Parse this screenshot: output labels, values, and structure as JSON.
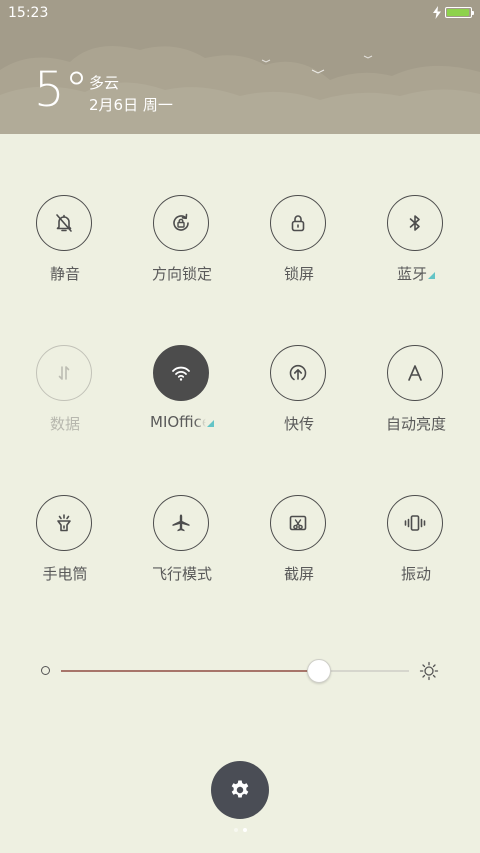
{
  "status_bar": {
    "time": "15:23",
    "battery_level": 0.95,
    "charging": true
  },
  "weather": {
    "temperature": "5°",
    "condition": "多云",
    "date": "2月6日 周一"
  },
  "toggles": [
    {
      "label": "静音",
      "icon": "bell-off-icon",
      "state": "off"
    },
    {
      "label": "方向锁定",
      "icon": "rotation-lock-icon",
      "state": "off"
    },
    {
      "label": "锁屏",
      "icon": "lock-icon",
      "state": "off"
    },
    {
      "label": "蓝牙",
      "icon": "bluetooth-icon",
      "state": "off",
      "has_submenu": true
    },
    {
      "label": "数据",
      "icon": "mobile-data-icon",
      "state": "disabled"
    },
    {
      "label": "MIOffice",
      "icon": "wifi-icon",
      "state": "on",
      "has_submenu": true
    },
    {
      "label": "快传",
      "icon": "quick-transfer-icon",
      "state": "off"
    },
    {
      "label": "自动亮度",
      "icon": "auto-brightness-icon",
      "state": "off"
    },
    {
      "label": "手电筒",
      "icon": "flashlight-icon",
      "state": "off"
    },
    {
      "label": "飞行模式",
      "icon": "airplane-icon",
      "state": "off"
    },
    {
      "label": "截屏",
      "icon": "screenshot-icon",
      "state": "off"
    },
    {
      "label": "振动",
      "icon": "vibrate-icon",
      "state": "off"
    }
  ],
  "brightness": {
    "level": 0.74
  },
  "pager": {
    "page_count": 2,
    "current": 1
  },
  "colors": {
    "background": "#eef0e1",
    "header": "#a39c8a",
    "active_toggle": "#4c4c4c",
    "submenu_indicator": "#63c4c6",
    "slider_fill": "#a7756a",
    "settings_button": "#4a4d55"
  }
}
